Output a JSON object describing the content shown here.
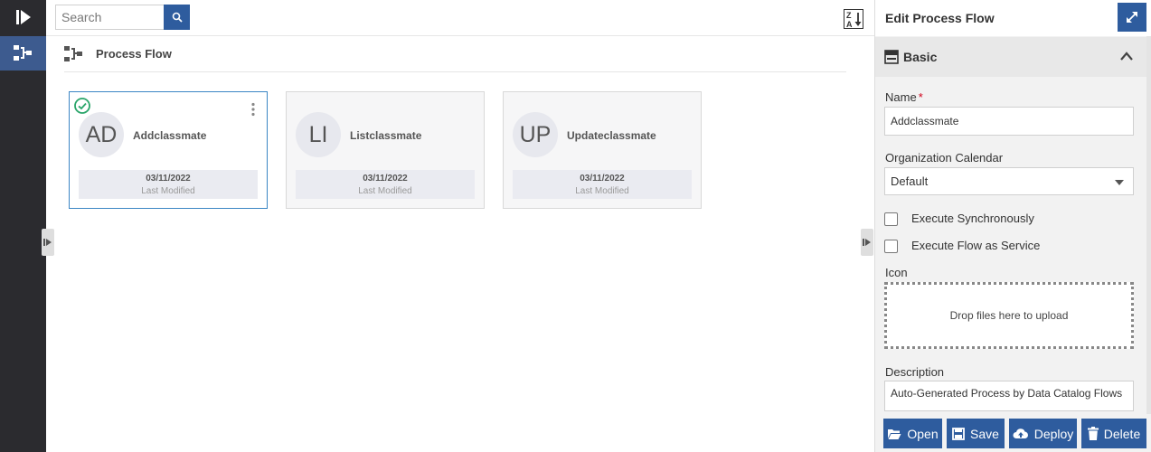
{
  "search": {
    "placeholder": "Search"
  },
  "section": {
    "title": "Process Flow"
  },
  "cards": [
    {
      "initials": "AD",
      "name": "Addclassmate",
      "date": "03/11/2022",
      "date_label": "Last Modified",
      "selected": true
    },
    {
      "initials": "LI",
      "name": "Listclassmate",
      "date": "03/11/2022",
      "date_label": "Last Modified",
      "selected": false
    },
    {
      "initials": "UP",
      "name": "Updateclassmate",
      "date": "03/11/2022",
      "date_label": "Last Modified",
      "selected": false
    }
  ],
  "panel": {
    "title": "Edit Process Flow",
    "accordion_title": "Basic",
    "name_label": "Name",
    "name_required_mark": "*",
    "name_value": "Addclassmate",
    "calendar_label": "Organization Calendar",
    "calendar_value": "Default",
    "exec_sync_label": "Execute Synchronously",
    "exec_service_label": "Execute Flow as Service",
    "icon_label": "Icon",
    "drop_text": "Drop files here to upload",
    "description_label": "Description",
    "description_value": "Auto-Generated Process by Data Catalog Flows"
  },
  "footer": {
    "open": "Open",
    "save": "Save",
    "deploy": "Deploy",
    "delete": "Delete"
  },
  "colors": {
    "accent": "#2e5c9e",
    "rail": "#2b2b2f",
    "selected_border": "#3b86c4",
    "check": "#2aa56a"
  }
}
